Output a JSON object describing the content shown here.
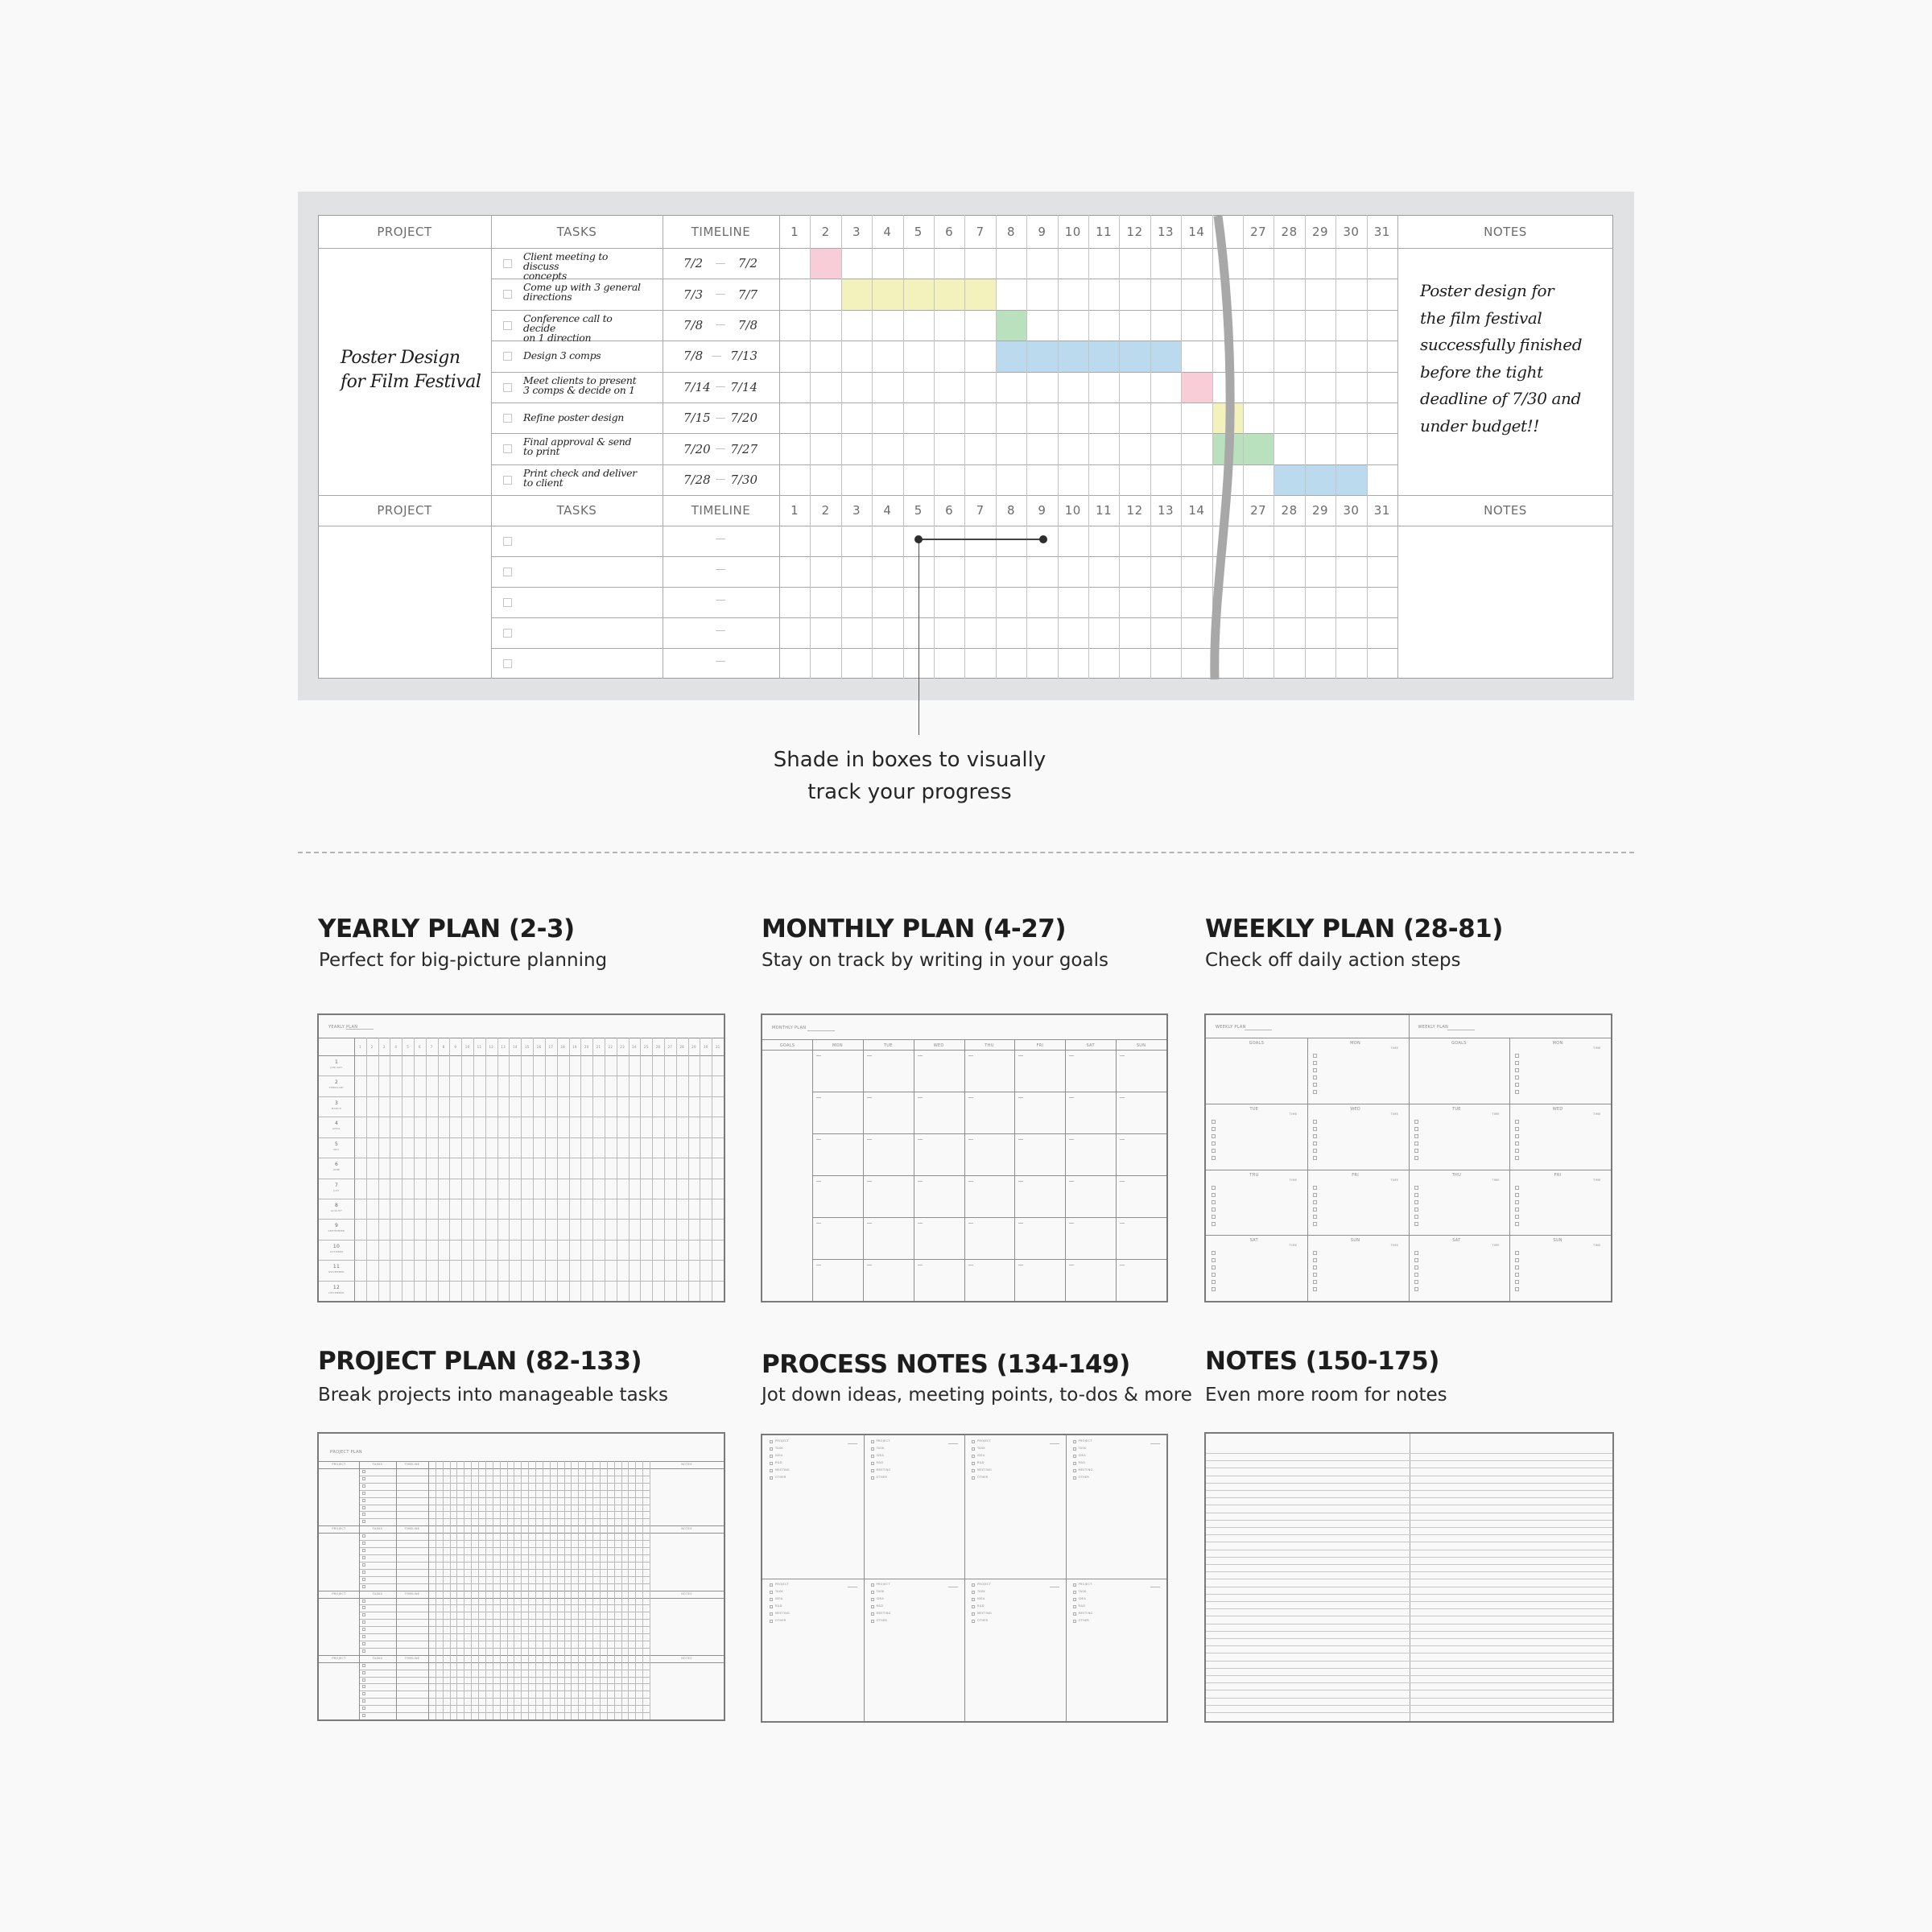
{
  "hero": {
    "headers": {
      "project": "PROJECT",
      "tasks": "TASKS",
      "timeline": "TIMELINE",
      "notes": "NOTES",
      "days_first": [
        "1",
        "2",
        "3",
        "4",
        "5",
        "6",
        "7",
        "8",
        "9",
        "10",
        "11",
        "12",
        "13",
        "14"
      ],
      "days_last": [
        "27",
        "28",
        "29",
        "30",
        "31"
      ]
    },
    "project_name_line1": "Poster Design",
    "project_name_line2": "for Film Festival",
    "tasks": [
      {
        "line1": "Client meeting to discuss",
        "line2": "concepts",
        "start": "7/2",
        "end": "7/2",
        "checked": false,
        "shade_days": [
          2
        ],
        "color": "#f8c8d4"
      },
      {
        "line1": "Come up with 3 general",
        "line2": "directions",
        "start": "7/3",
        "end": "7/7",
        "checked": false,
        "shade_days": [
          3,
          4,
          5,
          6,
          7
        ],
        "color": "#f2f1b6"
      },
      {
        "line1": "Conference call to decide",
        "line2": "on 1 direction",
        "start": "7/8",
        "end": "7/8",
        "checked": false,
        "shade_days": [
          8
        ],
        "color": "#b3deb6"
      },
      {
        "line1": "Design 3 comps",
        "line2": "",
        "start": "7/8",
        "end": "7/13",
        "checked": false,
        "shade_days": [
          8,
          9,
          10,
          11,
          12,
          13
        ],
        "color": "#b4d6ec"
      },
      {
        "line1": "Meet clients to present",
        "line2": "3 comps & decide on 1",
        "start": "7/14",
        "end": "7/14",
        "checked": false,
        "shade_days": [
          14
        ],
        "color": "#f8c8d4"
      },
      {
        "line1": "Refine poster design",
        "line2": "",
        "start": "7/15",
        "end": "7/20",
        "checked": false,
        "shade_days": [
          "gap"
        ],
        "color": "#f2f1b6"
      },
      {
        "line1": "Final approval & send",
        "line2": "to print",
        "start": "7/20",
        "end": "7/27",
        "checked": false,
        "shade_days": [
          "gap",
          27
        ],
        "color": "#b3deb6"
      },
      {
        "line1": "Print check and deliver",
        "line2": "to client",
        "start": "7/28",
        "end": "7/30",
        "checked": false,
        "shade_days": [
          28,
          29,
          30
        ],
        "color": "#b4d6ec"
      }
    ],
    "notes_lines": [
      "Poster design for",
      "the film festival",
      "successfully finished",
      "before the tight",
      "deadline of 7/30 and",
      "under budget!!"
    ],
    "empty_rows": 5,
    "timeline_dash": "—",
    "callout": {
      "line1": "Shade in boxes to visually",
      "line2": "track your progress"
    }
  },
  "sections": [
    {
      "title": "YEARLY PLAN (2-3)",
      "subtitle": "Perfect for big-picture planning",
      "preview_label": "YEARLY PLAN"
    },
    {
      "title": "MONTHLY PLAN (4-27)",
      "subtitle": "Stay on track by writing in your goals",
      "preview_label": "MONTHLY PLAN"
    },
    {
      "title": "WEEKLY PLAN (28-81)",
      "subtitle": "Check off daily action steps",
      "preview_label": "WEEKLY PLAN"
    },
    {
      "title": "PROJECT PLAN (82-133)",
      "subtitle": "Break projects into manageable tasks",
      "preview_label": "PROJECT PLAN"
    },
    {
      "title": "PROCESS NOTES (134-149)",
      "subtitle": "Jot down ideas, meeting points, to-dos & more",
      "preview_label": ""
    },
    {
      "title": "NOTES (150-175)",
      "subtitle": "Even more room for notes",
      "preview_label": ""
    }
  ],
  "yearly_preview": {
    "months": [
      "JANUARY",
      "FEBRUARY",
      "MARCH",
      "APRIL",
      "MAY",
      "JUNE",
      "JULY",
      "AUGUST",
      "SEPTEMBER",
      "OCTOBER",
      "NOVEMBER",
      "DECEMBER"
    ],
    "day_count": 31
  },
  "monthly_preview": {
    "goals": "GOALS",
    "weekdays": [
      "MON",
      "TUE",
      "WED",
      "THU",
      "FRI",
      "SAT",
      "SUN"
    ],
    "weeks": 6
  },
  "weekly_preview": {
    "goals": "GOALS",
    "days": [
      "MON",
      "TUE",
      "WED",
      "THU",
      "FRI",
      "SAT",
      "SUN"
    ],
    "time_label": "TIME"
  },
  "project_preview": {
    "headers": [
      "PROJECT",
      "TASKS",
      "TIMELINE",
      "NOTES"
    ],
    "blocks": 4,
    "rows_per_block": 8,
    "day_count": 31
  },
  "process_preview": {
    "categories": [
      "PROJECT",
      "TASK",
      "IDEA",
      "R&D",
      "MEETING",
      "OTHER"
    ],
    "date_mark": "/"
  }
}
